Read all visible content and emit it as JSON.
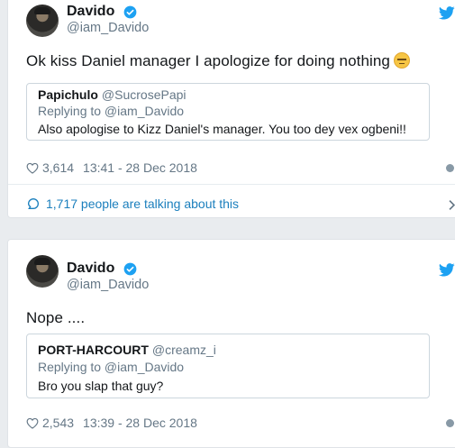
{
  "tweets": [
    {
      "author_name": "Davido",
      "author_handle": "@iam_Davido",
      "text": "Ok kiss Daniel manager I apologize for doing nothing",
      "emoji": "unamused-face-emoji",
      "quoted": {
        "name": "Papichulo",
        "handle": "@SucrosePapi",
        "replying": "Replying to @iam_Davido",
        "text": "Also apologise to Kizz Daniel's manager. You too dey vex ogbeni!!"
      },
      "likes": "3,614",
      "timestamp": "13:41 - 28 Dec 2018",
      "talking": "1,717 people are talking about this"
    },
    {
      "author_name": "Davido",
      "author_handle": "@iam_Davido",
      "text": "Nope ....",
      "quoted": {
        "name": "PORT-HARCOURT",
        "handle": "@creamz_i",
        "replying": "Replying to @iam_Davido",
        "text": "Bro you slap that guy?"
      },
      "likes": "2,543",
      "timestamp": "13:39 - 28 Dec 2018"
    }
  ],
  "colors": {
    "verified": "#1da1f2",
    "link": "#1b7fbd",
    "muted": "#657786"
  },
  "icons": [
    "verified-badge-icon",
    "twitter-bird-icon",
    "heart-icon",
    "info-icon",
    "comment-icon",
    "chevron-right-icon"
  ]
}
